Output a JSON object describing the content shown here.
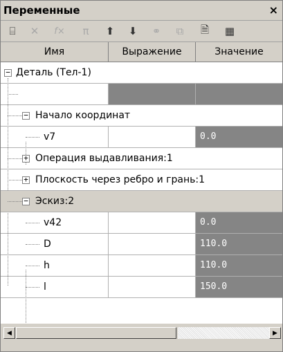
{
  "window": {
    "title": "Переменные",
    "close": "×"
  },
  "toolbar": [
    {
      "icon": "table-icon",
      "glyph": "⌸",
      "enabled": true
    },
    {
      "icon": "delete-icon",
      "glyph": "✕",
      "enabled": false
    },
    {
      "icon": "function-icon",
      "glyph": "f×",
      "enabled": false
    },
    {
      "icon": "pi-icon",
      "glyph": "π",
      "enabled": false
    },
    {
      "icon": "move-up-icon",
      "glyph": "⬆",
      "enabled": true
    },
    {
      "icon": "move-down-icon",
      "glyph": "⬇",
      "enabled": true
    },
    {
      "icon": "link-icon",
      "glyph": "⚭",
      "enabled": false
    },
    {
      "icon": "fields-icon",
      "glyph": "⧉",
      "enabled": false
    },
    {
      "icon": "document-icon",
      "glyph": "🗎",
      "enabled": true
    },
    {
      "icon": "grid-icon",
      "glyph": "▦",
      "enabled": true
    }
  ],
  "columns": [
    "Имя",
    "Выражение",
    "Значение"
  ],
  "rows": [
    {
      "label": "Деталь (Тел-1)",
      "value": "",
      "expander": "−"
    },
    {
      "label": "",
      "value": ""
    },
    {
      "label": "Начало координат",
      "value": "",
      "expander": "−"
    },
    {
      "label": "v7",
      "value": "0.0"
    },
    {
      "label": "Операция выдавливания:1",
      "value": "",
      "expander": "+"
    },
    {
      "label": "Плоскость через ребро и грань:1",
      "value": "",
      "expander": "+"
    },
    {
      "label": "Эскиз:2",
      "value": "",
      "expander": "−"
    },
    {
      "label": "v42",
      "value": "0.0"
    },
    {
      "label": "D",
      "value": "110.0"
    },
    {
      "label": "h",
      "value": "110.0"
    },
    {
      "label": "l",
      "value": "150.0"
    }
  ],
  "scrollbar": {
    "left_arrow": "◀",
    "right_arrow": "▶"
  },
  "colors": {
    "dark_cell": "#858585",
    "panel": "#d4d0c8"
  }
}
